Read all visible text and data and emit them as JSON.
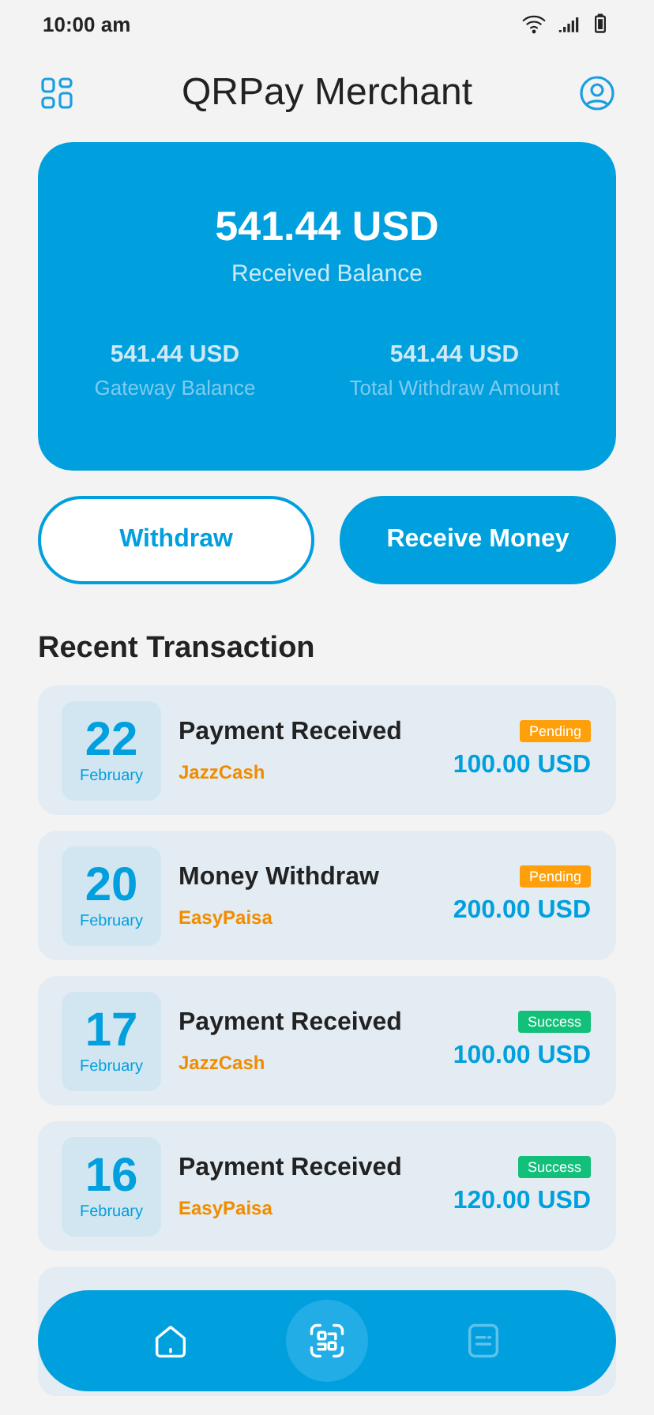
{
  "status_bar": {
    "time": "10:00 am"
  },
  "header": {
    "title": "QRPay Merchant"
  },
  "balance_card": {
    "amount": "541.44 USD",
    "label": "Received Balance",
    "stats": [
      {
        "amount": "541.44 USD",
        "label": "Gateway Balance"
      },
      {
        "amount": "541.44 USD",
        "label": "Total Withdraw Amount"
      }
    ]
  },
  "actions": [
    {
      "label": "Withdraw",
      "kind": "outline"
    },
    {
      "label": "Receive Money",
      "kind": "filled"
    }
  ],
  "section_title": "Recent Transaction",
  "transactions": [
    {
      "day": "22",
      "month": "February",
      "title": "Payment Received",
      "method": "JazzCash",
      "status": "Pending",
      "color": "#ff9f0a",
      "amount": "100.00 USD"
    },
    {
      "day": "20",
      "month": "February",
      "title": "Money Withdraw",
      "method": "EasyPaisa",
      "status": "Pending",
      "color": "#ff9f0a",
      "amount": "200.00 USD"
    },
    {
      "day": "17",
      "month": "February",
      "title": "Payment Received",
      "method": "JazzCash",
      "status": "Success",
      "color": "#12c07a",
      "amount": "100.00 USD"
    },
    {
      "day": "16",
      "month": "February",
      "title": "Payment Received",
      "method": "EasyPaisa",
      "status": "Success",
      "color": "#12c07a",
      "amount": "120.00 USD"
    }
  ],
  "bottom_nav": [
    {
      "kind": "home",
      "selected": false,
      "disabled": false
    },
    {
      "kind": "scan",
      "selected": true,
      "disabled": false
    },
    {
      "kind": "receipt",
      "selected": false,
      "disabled": true
    }
  ]
}
